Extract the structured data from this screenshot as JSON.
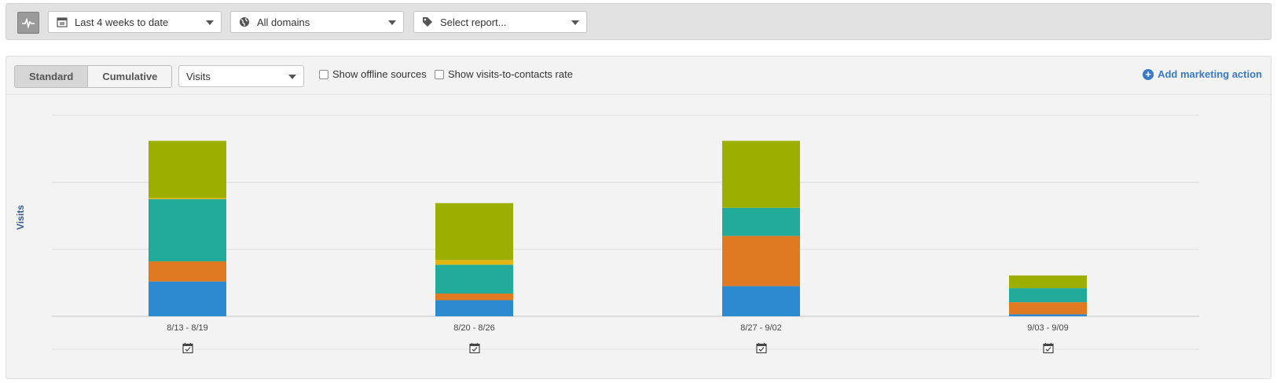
{
  "toolbar": {
    "pulse_icon": "pulse-icon",
    "date_range": {
      "label": "Last 4 weeks to date",
      "icon": "calendar-icon"
    },
    "domains": {
      "label": "All domains",
      "icon": "globe-icon"
    },
    "report": {
      "label": "Select report...",
      "icon": "tag-icon"
    }
  },
  "controls": {
    "standard_label": "Standard",
    "cumulative_label": "Cumulative",
    "metric": "Visits",
    "offline_label": "Show offline sources",
    "rate_label": "Show visits-to-contacts rate",
    "add_action_label": "Add marketing action"
  },
  "chart_data": {
    "type": "bar",
    "stacked": true,
    "ylabel": "Visits",
    "categories": [
      "8/13 - 8/19",
      "8/20 - 8/26",
      "8/27 - 9/02",
      "9/03 - 9/09"
    ],
    "ylim": [
      0,
      300
    ],
    "grid": true,
    "series": [
      {
        "color": "#2b8ad0",
        "values": [
          52,
          24,
          45,
          3
        ]
      },
      {
        "color": "#e07a22",
        "values": [
          30,
          10,
          75,
          18
        ]
      },
      {
        "color": "#22aa9a",
        "values": [
          93,
          43,
          42,
          21
        ]
      },
      {
        "color": "#e2b512",
        "values": [
          2,
          7,
          0,
          0
        ]
      },
      {
        "color": "#9caf00",
        "values": [
          85,
          85,
          100,
          19
        ]
      }
    ],
    "marker_icon": "calendar-check-icon"
  }
}
